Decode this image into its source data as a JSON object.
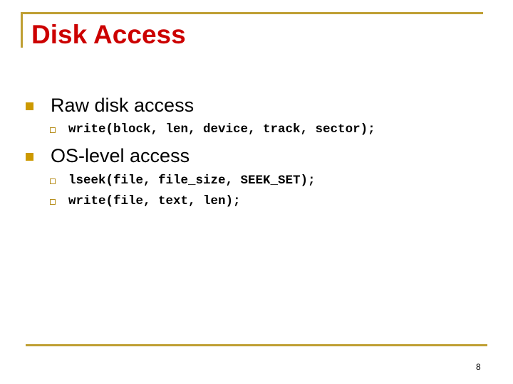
{
  "slide": {
    "title": "Disk Access",
    "accent_color": "#bf9f33",
    "title_color": "#cc0000",
    "bullets": [
      {
        "text": "Raw disk access",
        "sub": [
          "write(block, len, device, track, sector);"
        ]
      },
      {
        "text": "OS-level access",
        "sub": [
          "lseek(file, file_size, SEEK_SET);",
          "write(file, text, len);"
        ]
      }
    ],
    "page_number": "8"
  }
}
